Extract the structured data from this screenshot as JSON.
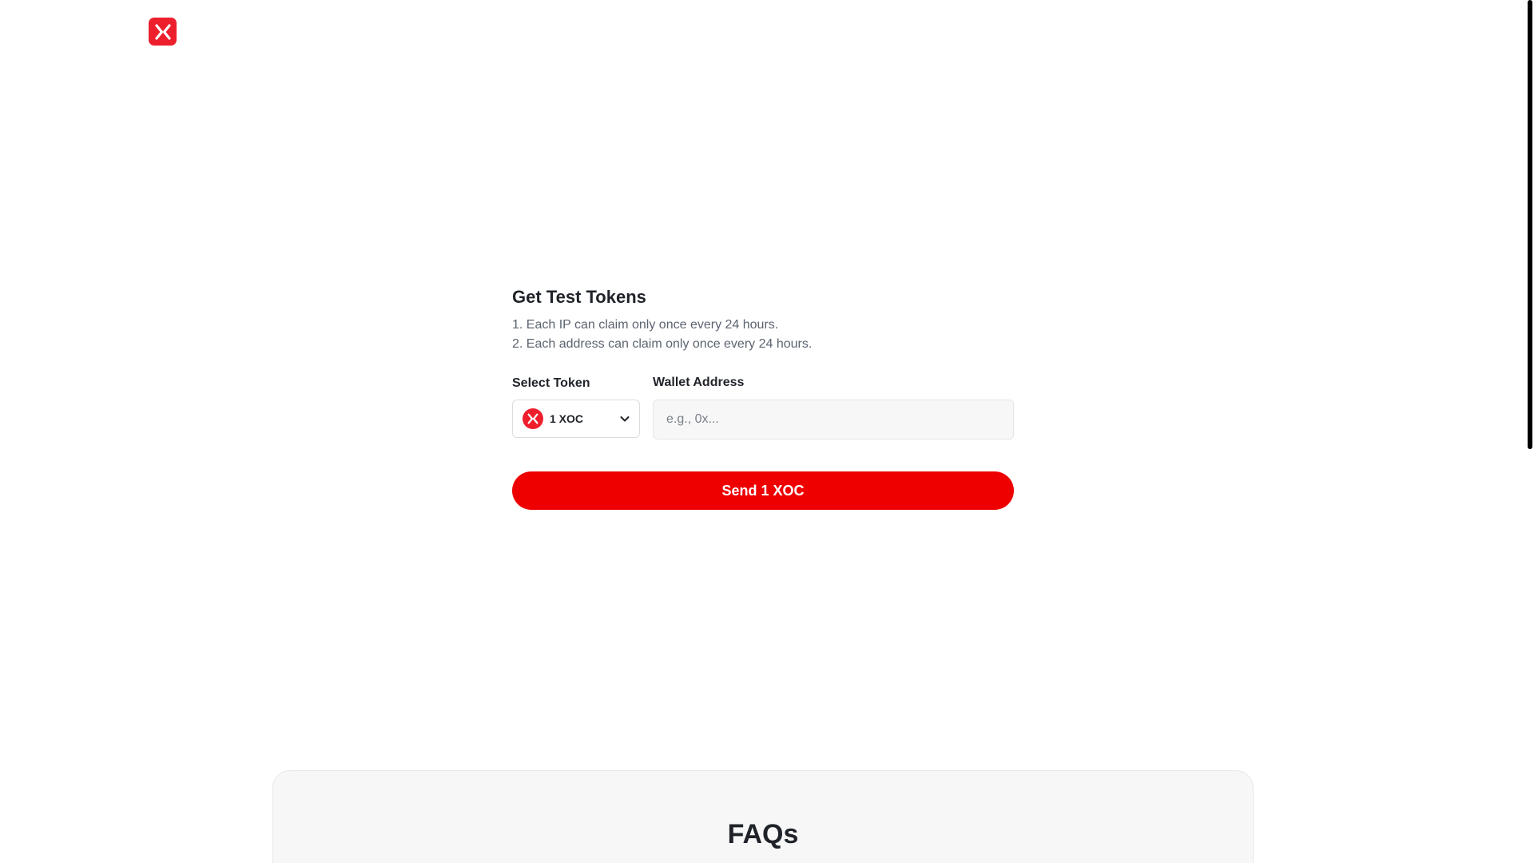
{
  "header": {
    "logo_icon": "x-logo-icon",
    "brand_color": "#ee1f2d"
  },
  "faucet": {
    "title": "Get Test Tokens",
    "rules": [
      "1. Each IP can claim only once every 24 hours.",
      "2. Each address can claim only once every 24 hours."
    ],
    "token_label": "Select Token",
    "token_value": "1 XOC",
    "token_icon": "xoc-token-icon",
    "wallet_label": "Wallet Address",
    "wallet_value": "",
    "wallet_placeholder": "e.g., 0x...",
    "send_label": "Send 1 XOC",
    "accent_color": "#ee0000"
  },
  "faq": {
    "title": "FAQs"
  }
}
